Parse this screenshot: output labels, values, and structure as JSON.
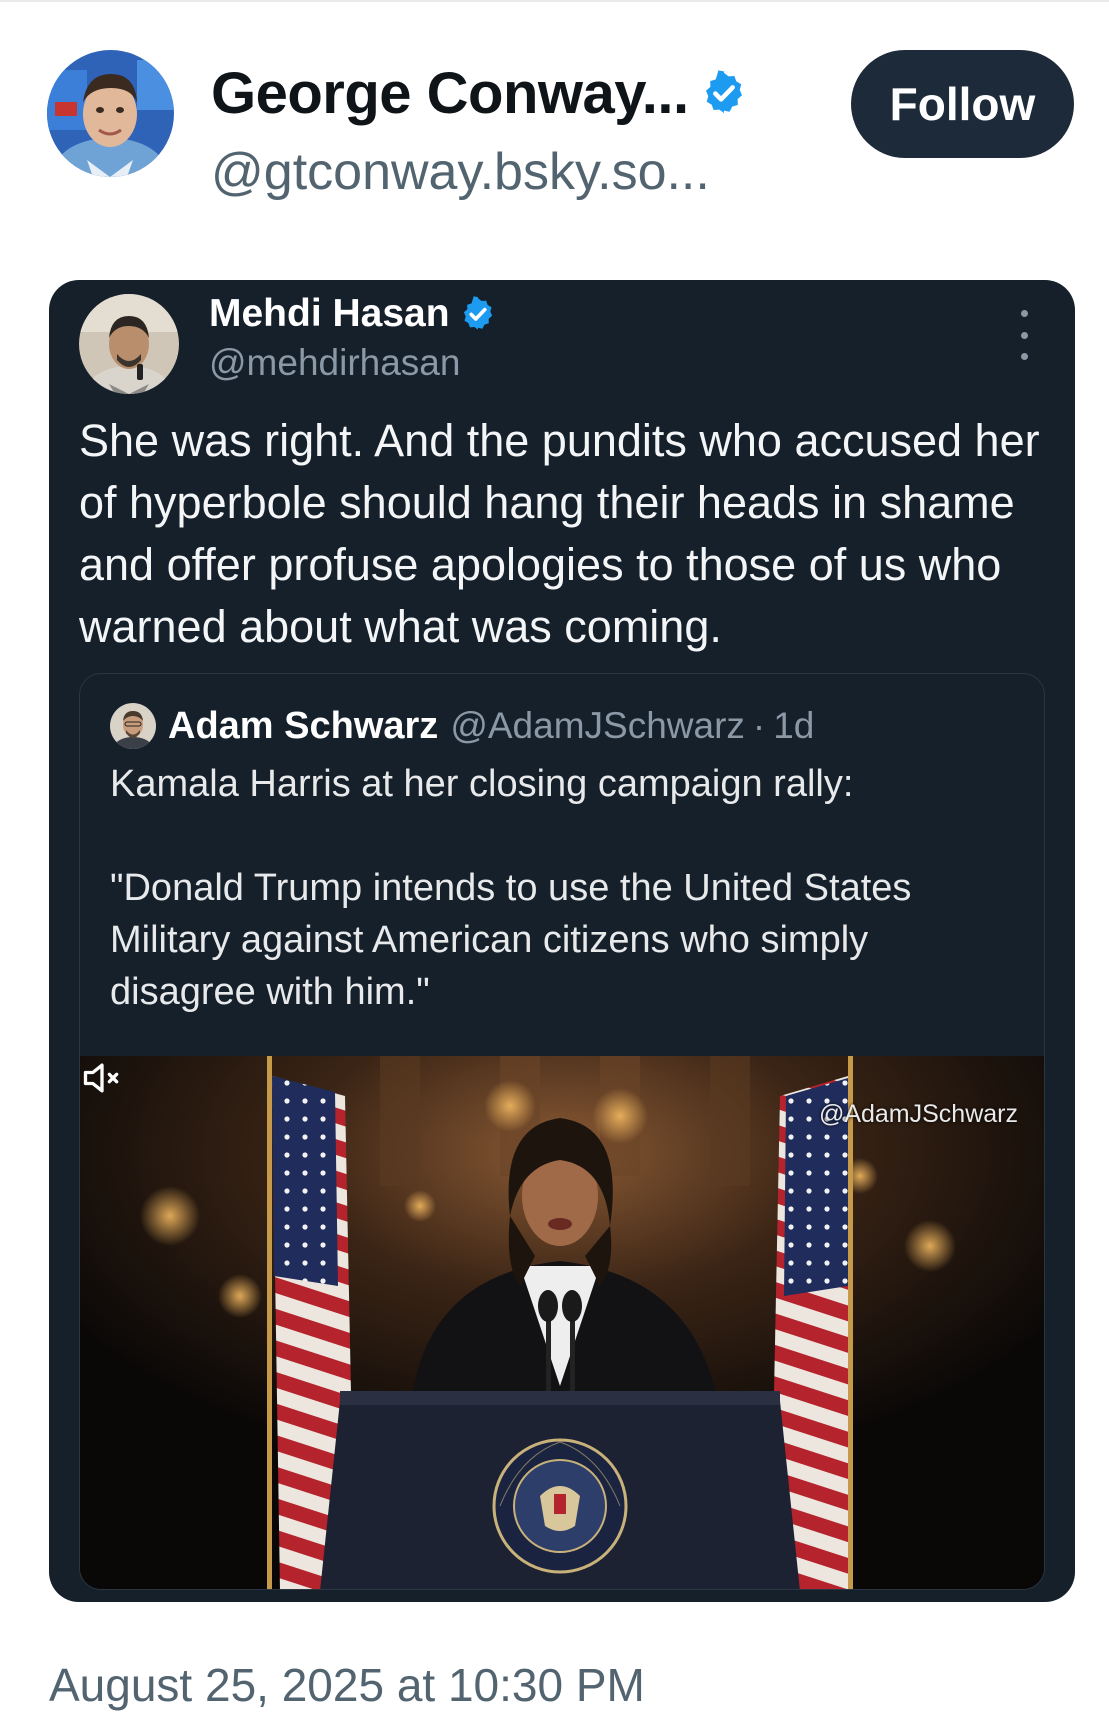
{
  "author": {
    "display_name": "George Conway...",
    "handle": "@gtconway.bsky.so...",
    "verified": true,
    "follow_label": "Follow"
  },
  "embedded_post": {
    "display_name": "Mehdi Hasan",
    "handle": "@mehdirhasan",
    "verified": true,
    "menu_icon": "more-vertical-icon",
    "body": "She was right. And the pundits who accused her of hyperbole should hang their heads in shame and offer profuse apologies to those of us who warned about what was coming.",
    "quoted": {
      "display_name": "Adam Schwarz",
      "handle": "@AdamJSchwarz",
      "separator": "·",
      "time": "1d",
      "line1": "Kamala Harris at her closing campaign rally:",
      "line2": "\"Donald Trump intends to use the United States Military against American citizens who simply disagree with him.\"",
      "media": {
        "watermark": "@AdamJSchwarz",
        "seal_text": "PRESIDENT OF THE UNITED STATES",
        "mute_icon": "speaker-muted-icon"
      }
    }
  },
  "timestamp": "August 25, 2025 at 10:30 PM",
  "colors": {
    "card_bg": "#15202b",
    "follow_bg": "#1d2a39",
    "verified": "#1d9bf0",
    "secondary_text": "#536471"
  }
}
